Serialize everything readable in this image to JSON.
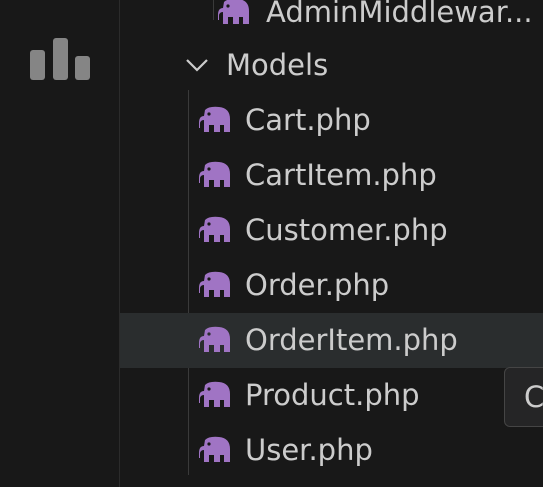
{
  "activity_bar": {
    "icon": "bar-chart-icon"
  },
  "explorer": {
    "parent_item": {
      "label": "AdminMiddlewar...",
      "icon": "php-elephant-icon"
    },
    "folder": {
      "label": "Models",
      "icon": "chevron-down-icon",
      "expanded": true
    },
    "files": [
      {
        "label": "Cart.php",
        "icon": "php-elephant-icon"
      },
      {
        "label": "CartItem.php",
        "icon": "php-elephant-icon"
      },
      {
        "label": "Customer.php",
        "icon": "php-elephant-icon"
      },
      {
        "label": "Order.php",
        "icon": "php-elephant-icon"
      },
      {
        "label": "OrderItem.php",
        "icon": "php-elephant-icon",
        "selected": true
      },
      {
        "label": "Product.php",
        "icon": "php-elephant-icon"
      },
      {
        "label": "User.php",
        "icon": "php-elephant-icon"
      }
    ]
  },
  "tooltip": {
    "text": "C"
  },
  "colors": {
    "background": "#181818",
    "text": "#cccccc",
    "php_icon": "#a074c4",
    "selection": "#2a2d2e",
    "guide": "#3a3a3a"
  }
}
